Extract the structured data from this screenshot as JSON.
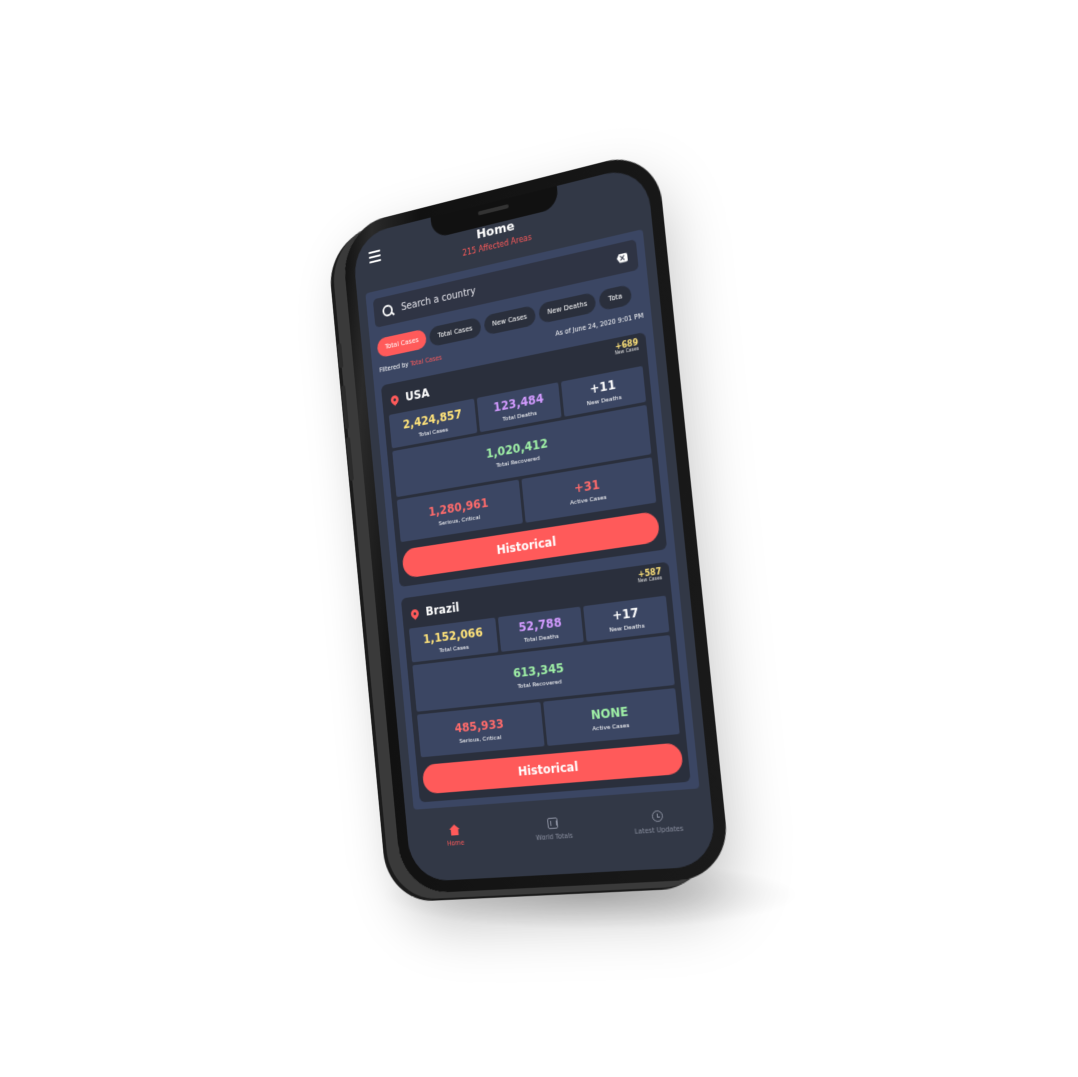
{
  "header": {
    "title": "Home",
    "subtitle": "215 Affected Areas"
  },
  "search": {
    "placeholder": "Search a country"
  },
  "filters": {
    "chips": [
      "Total Cases",
      "Total Cases",
      "New Cases",
      "New Deaths",
      "Tota"
    ],
    "active_index": 0,
    "filtered_by_label": "Filtered by",
    "filtered_by_value": "Total Cases",
    "as_of": "As of June 24, 2020 9:01 PM"
  },
  "countries": [
    {
      "name": "USA",
      "new_cases": "+689",
      "new_cases_label": "New Cases",
      "total_cases": "2,424,857",
      "total_cases_label": "Total Cases",
      "total_deaths": "123,484",
      "total_deaths_label": "Total Deaths",
      "new_deaths": "+11",
      "new_deaths_label": "New Deaths",
      "total_recovered": "1,020,412",
      "total_recovered_label": "Total Recovered",
      "serious_critical": "1,280,961",
      "serious_critical_label": "Serious, Critical",
      "active_cases": "+31",
      "active_cases_label": "Active Cases",
      "button_label": "Historical"
    },
    {
      "name": "Brazil",
      "new_cases": "+587",
      "new_cases_label": "New Cases",
      "total_cases": "1,152,066",
      "total_cases_label": "Total Cases",
      "total_deaths": "52,788",
      "total_deaths_label": "Total Deaths",
      "new_deaths": "+17",
      "new_deaths_label": "New Deaths",
      "total_recovered": "613,345",
      "total_recovered_label": "Total Recovered",
      "serious_critical": "485,933",
      "serious_critical_label": "Serious, Critical",
      "active_cases": "NONE",
      "active_cases_label": "Active Cases",
      "button_label": "Historical"
    }
  ],
  "nav": {
    "items": [
      {
        "label": "Home",
        "icon": "home-icon"
      },
      {
        "label": "World Totals",
        "icon": "bar-chart-icon"
      },
      {
        "label": "Latest Updates",
        "icon": "clock-icon"
      }
    ]
  },
  "colors": {
    "accent": "#ff5a5a",
    "background": "#323846",
    "card": "#2a2f3c",
    "cell": "#3b4663",
    "yellow": "#ffe37a",
    "purple": "#d39bff",
    "green": "#9ff0a6"
  }
}
